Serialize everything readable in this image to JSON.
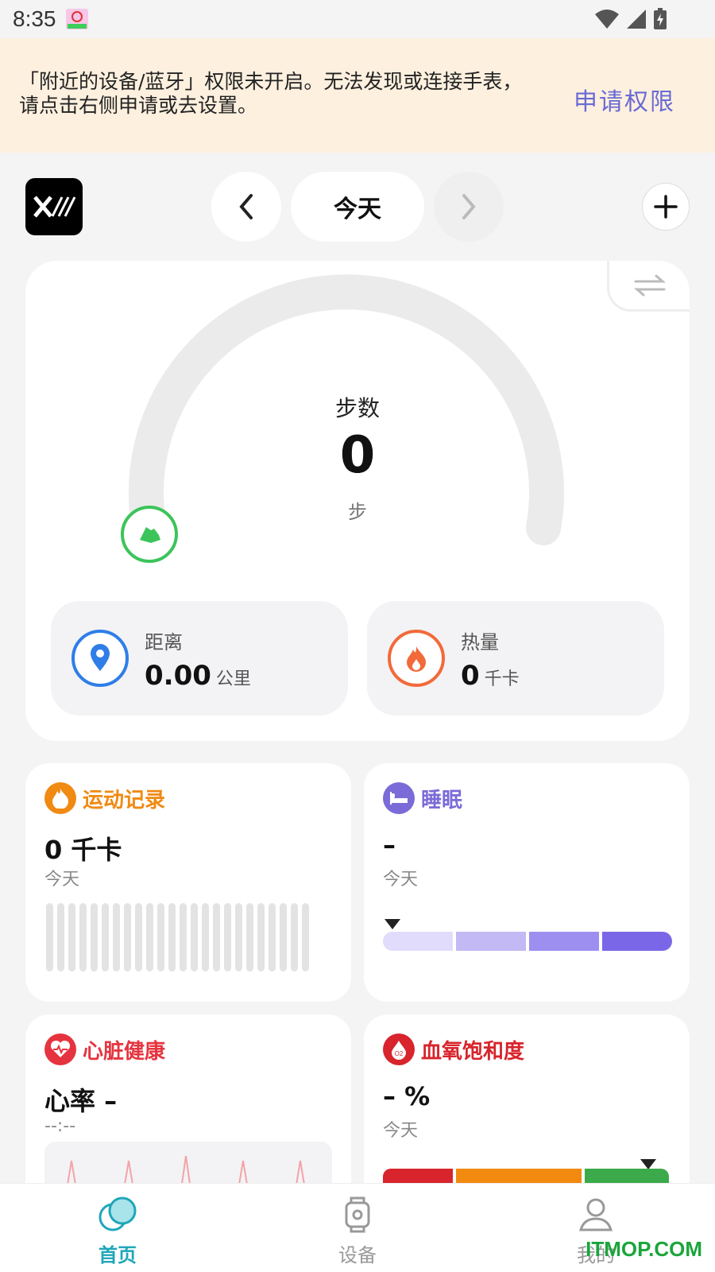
{
  "status_bar": {
    "time": "8:35"
  },
  "banner": {
    "message": "「附近的设备/蓝牙」权限未开启。无法发现或连接手表，\n请点击右侧申请或去设置。",
    "action": "申请权限"
  },
  "header": {
    "date": "今天"
  },
  "steps": {
    "title": "步数",
    "value": "0",
    "unit": "步",
    "progress": 0
  },
  "distance": {
    "label": "距离",
    "value": "0.00",
    "unit": "公里"
  },
  "calories": {
    "label": "热量",
    "value": "0",
    "unit": "千卡"
  },
  "tiles": {
    "exercise": {
      "title": "运动记录",
      "value": "0 千卡",
      "sub": "今天"
    },
    "sleep": {
      "title": "睡眠",
      "value": "–",
      "sub": "今天"
    },
    "heart": {
      "title": "心脏健康",
      "value": "心率 –",
      "sub": "--:--"
    },
    "spo2": {
      "title": "血氧饱和度",
      "value": "– %",
      "sub": "今天"
    }
  },
  "nav": [
    {
      "label": "首页",
      "active": true
    },
    {
      "label": "设备",
      "active": false
    },
    {
      "label": "我的",
      "active": false
    }
  ],
  "watermark": "ITMOP.COM",
  "colors": {
    "accent": "#6a6ad4",
    "nav_active": "#1fa6b8",
    "steps_green": "#3cc45a",
    "distance_blue": "#2f7ee8",
    "calorie_orange": "#f26a3a",
    "exercise_orange": "#f08a13",
    "sleep_purple": "#7b6bd8",
    "heart_red": "#e5343f",
    "spo2_red": "#d8242c"
  },
  "icons": {
    "notification": "avatar-notification-icon",
    "wifi": "wifi-icon",
    "signal": "signal-icon",
    "battery": "battery-charging-icon"
  }
}
